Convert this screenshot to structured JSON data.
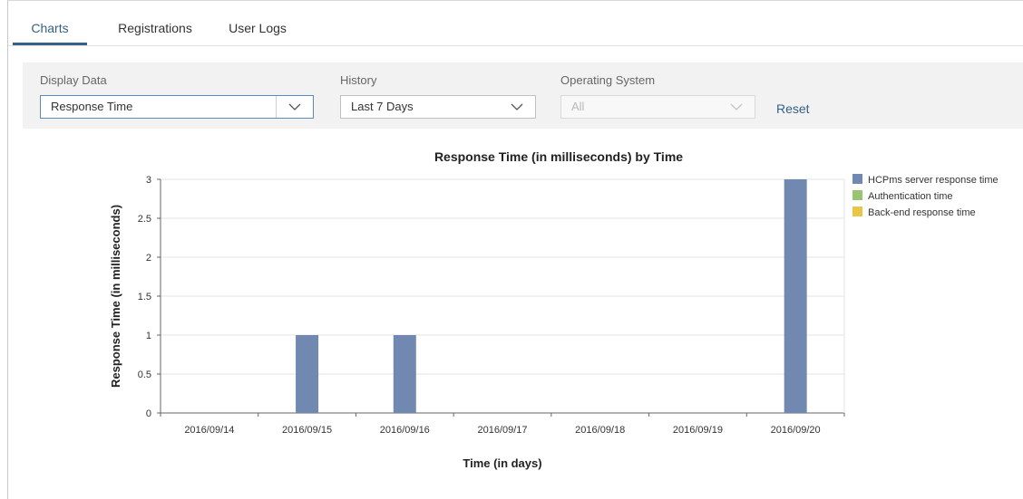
{
  "tabs": [
    {
      "label": "Charts",
      "active": true
    },
    {
      "label": "Registrations",
      "active": false
    },
    {
      "label": "User Logs",
      "active": false
    }
  ],
  "filters": {
    "display_data": {
      "label": "Display Data",
      "value": "Response Time"
    },
    "history": {
      "label": "History",
      "value": "Last 7 Days"
    },
    "operating_system": {
      "label": "Operating System",
      "value": "All",
      "disabled": true
    },
    "reset_label": "Reset"
  },
  "colors": {
    "accent": "#346187",
    "series_hcpms": "#7189b0",
    "series_auth": "#99c474",
    "series_backend": "#e9c647"
  },
  "chart_data": {
    "type": "bar",
    "title": "Response Time (in milliseconds) by Time",
    "xlabel": "Time (in days)",
    "ylabel": "Response Time (in milliseconds)",
    "ylim": [
      0,
      3
    ],
    "yticks": [
      "0",
      "0.5",
      "1",
      "1.5",
      "2",
      "2.5",
      "3"
    ],
    "grid": true,
    "legend_position": "right",
    "categories": [
      "2016/09/14",
      "2016/09/15",
      "2016/09/16",
      "2016/09/17",
      "2016/09/18",
      "2016/09/19",
      "2016/09/20"
    ],
    "series": [
      {
        "name": "HCPms server response time",
        "color": "#7189b0",
        "values": [
          0,
          1,
          1,
          0,
          0,
          0,
          3
        ]
      },
      {
        "name": "Authentication time",
        "color": "#99c474",
        "values": [
          0,
          0,
          0,
          0,
          0,
          0,
          0
        ]
      },
      {
        "name": "Back-end response time",
        "color": "#e9c647",
        "values": [
          0,
          0,
          0,
          0,
          0,
          0,
          0
        ]
      }
    ]
  }
}
